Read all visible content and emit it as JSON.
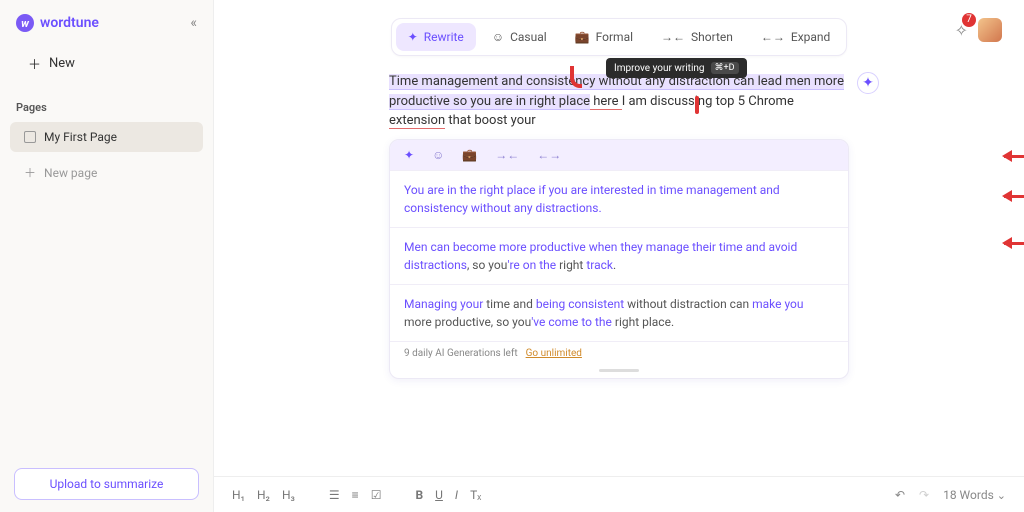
{
  "brand": {
    "name": "wordtune",
    "logo_letter": "w"
  },
  "sidebar": {
    "new_label": "New",
    "section_title": "Pages",
    "items": [
      {
        "label": "My First Page",
        "active": true
      }
    ],
    "new_page_label": "New page",
    "upload_label": "Upload to summarize"
  },
  "notification_count": "7",
  "toolbar": {
    "rewrite": "Rewrite",
    "casual": "Casual",
    "formal": "Formal",
    "shorten": "Shorten",
    "expand": "Expand"
  },
  "tooltip": {
    "text": "Improve your writing",
    "shortcut": "⌘+D"
  },
  "document": {
    "highlighted": "Time management and consistency without any distraction can lead men more productive so you are in right place",
    "plain1": " here ",
    "plain2": "I am discussing top 5 Chrome ",
    "extension_word": "extension",
    "plain3": " that boost your"
  },
  "panel": {
    "suggestions": [
      {
        "parts": [
          {
            "t": "You are in the right place if you are interested in time management and consistency without any distractions.",
            "c": "s-purple"
          }
        ]
      },
      {
        "parts": [
          {
            "t": "Men can become more productive when they manage their time and avoid distractions",
            "c": "s-purple"
          },
          {
            "t": ", so you",
            "c": "s-grey"
          },
          {
            "t": "'re on the",
            "c": "s-purple"
          },
          {
            "t": " right ",
            "c": "s-grey"
          },
          {
            "t": "track",
            "c": "s-purple"
          },
          {
            "t": ".",
            "c": "s-grey"
          }
        ]
      },
      {
        "parts": [
          {
            "t": "Managing your",
            "c": "s-purple"
          },
          {
            "t": " time and ",
            "c": "s-grey"
          },
          {
            "t": "being consistent",
            "c": "s-purple"
          },
          {
            "t": " without distraction can ",
            "c": "s-grey"
          },
          {
            "t": "make you",
            "c": "s-purple"
          },
          {
            "t": " more productive, so you",
            "c": "s-grey"
          },
          {
            "t": "'ve come to the",
            "c": "s-purple"
          },
          {
            "t": " right place.",
            "c": "s-grey"
          }
        ]
      }
    ],
    "footer_text": "9 daily AI Generations left",
    "go_unlimited": "Go unlimited"
  },
  "bottombar": {
    "h1": "H₁",
    "h2": "H₂",
    "h3": "H₃",
    "bold": "B",
    "underline": "U",
    "italic": "I",
    "clear": "Tₓ",
    "word_count": "18 Words"
  }
}
